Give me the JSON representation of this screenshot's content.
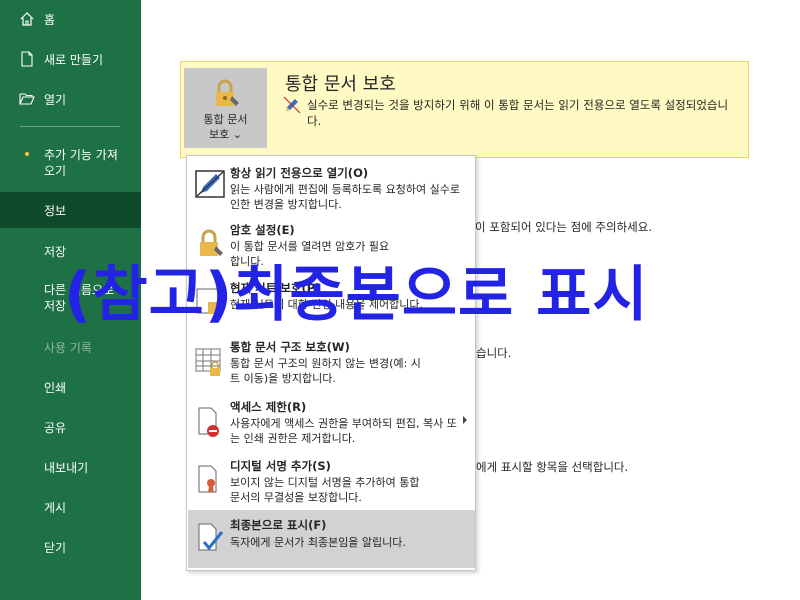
{
  "sidebar": {
    "items": [
      {
        "label": "홈"
      },
      {
        "label": "새로 만들기"
      },
      {
        "label": "열기"
      },
      {
        "label": "추가 기능 가져오기"
      },
      {
        "label": "정보"
      },
      {
        "label": "저장"
      },
      {
        "label": "다른 이름으로 저장"
      },
      {
        "label": "사용 기록"
      },
      {
        "label": "인쇄"
      },
      {
        "label": "공유"
      },
      {
        "label": "내보내기"
      },
      {
        "label": "게시"
      },
      {
        "label": "닫기"
      }
    ]
  },
  "protect": {
    "button_label_line1": "통합 문서",
    "button_label_line2": "보호",
    "title": "통합 문서 보호",
    "description": "실수로 변경되는 것을 방지하기 위해 이 통합 문서는 읽기 전용으로 열도록 설정되었습니다."
  },
  "background_texts": {
    "line1": "이 포함되어 있다는 점에 주의하세요.",
    "line2": "습니다.",
    "line3": "에게 표시할 항목을 선택합니다."
  },
  "menu": {
    "items": [
      {
        "title": "항상 읽기 전용으로 열기(O)",
        "desc": "읽는 사람에게 편집에 등록하도록 요청하여 실수로 인한 변경을 방지합니다.",
        "icon": "read-only-pencil-icon"
      },
      {
        "title": "암호 설정(E)",
        "desc": "이 통합 문서를 열려면 암호가 필요합니다.",
        "icon": "lock-key-icon"
      },
      {
        "title": "현재 시트 보호(P)",
        "desc": "현재 시트에 대한 변경 내용을 제어합니다.",
        "icon": "sheet-lock-icon"
      },
      {
        "title": "통합 문서 구조 보호(W)",
        "desc": "통합 문서 구조의 원하지 않는 변경(예: 시트 이동)을 방지합니다.",
        "icon": "grid-lock-icon"
      },
      {
        "title": "액세스 제한(R)",
        "desc": "사용자에게 액세스 권한을 부여하되 편집, 복사 또는 인쇄 권한은 제거합니다.",
        "icon": "restrict-access-icon"
      },
      {
        "title": "디지털 서명 추가(S)",
        "desc": "보이지 않는 디지털 서명을 추가하여 통합 문서의 무결성을 보장합니다.",
        "icon": "signature-ribbon-icon"
      },
      {
        "title": "최종본으로 표시(F)",
        "desc": "독자에게 문서가 최종본임을 알립니다.",
        "icon": "mark-final-icon"
      }
    ]
  },
  "overlay": {
    "caption": "(참고)최종본으로 표시"
  },
  "colors": {
    "sidebar_green": "#1e7145",
    "sidebar_active": "#0f4a2a",
    "protect_bg": "#fff9c4",
    "menu_highlight": "#d2d2d2",
    "overlay_blue": "#2323e6"
  }
}
